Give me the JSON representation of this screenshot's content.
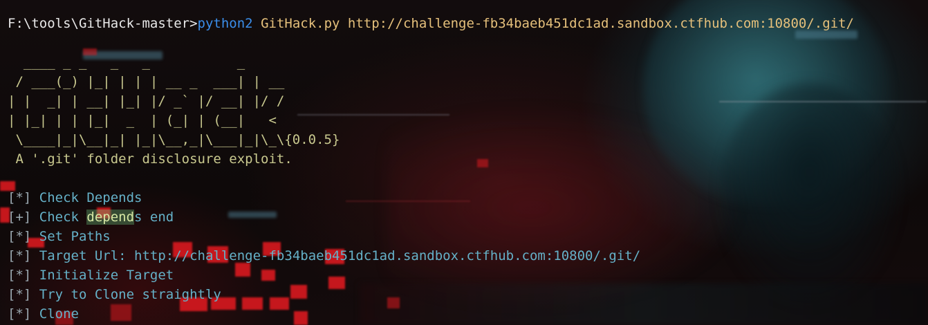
{
  "terminal": {
    "prompt": "F:\\tools\\GitHack-master>",
    "command_exe": "python2",
    "command_rest": " GitHack.py http://challenge-fb34baeb451dc1ad.sandbox.ctfhub.com:10800/.git/"
  },
  "banner": {
    "lines": [
      "  ____ _ _   _   _           _",
      " / ___(_) |_| | | | __ _  ___| | __",
      "| |  _| | __| |_| |/ _` |/ __| |/ /",
      "| |_| | | |_|  _  | (_| | (__|   <",
      " \\____|_|\\__|_| |_|\\__,_|\\___|_|\\_\\{0.0.5}",
      " A '.git' folder disclosure exploit."
    ]
  },
  "log": {
    "lines": [
      {
        "tag": "[*]",
        "text": " Check Depends"
      },
      {
        "tag": "[+]",
        "text_before": " Check ",
        "highlight": "depend",
        "text_after": "s end"
      },
      {
        "tag": "[*]",
        "text": " Set Paths"
      },
      {
        "tag": "[*]",
        "text": " Target Url: http://challenge-fb34baeb451dc1ad.sandbox.ctfhub.com:10800/.git/"
      },
      {
        "tag": "[*]",
        "text": " Initialize Target"
      },
      {
        "tag": "[*]",
        "text": " Try to Clone straightly"
      },
      {
        "tag": "[*]",
        "text": " Clone"
      }
    ]
  },
  "colors": {
    "prompt": "#e8e8e8",
    "command": "#3b8eea",
    "command_args": "#e5c07b",
    "banner": "#c9c98f",
    "log_tag": "#9aa8b0",
    "log_text": "#65b1c8",
    "background_red": "#d9191f",
    "background_teal": "#3c8c96"
  }
}
